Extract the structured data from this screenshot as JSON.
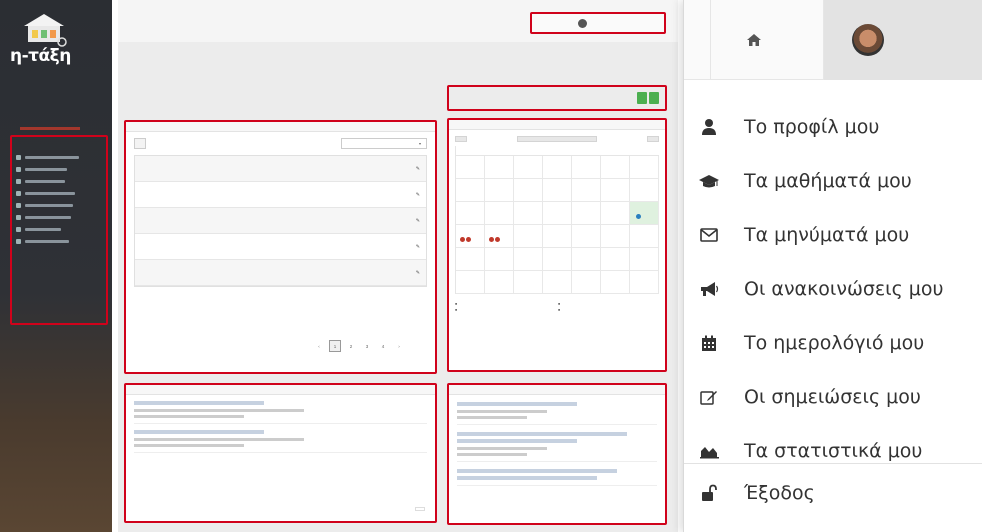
{
  "sidebar": {
    "brand": "η-τάξη",
    "section_label": "",
    "items": [
      {
        "icon": "dashboard-icon"
      },
      {
        "icon": "book-icon"
      },
      {
        "icon": "envelope-icon"
      },
      {
        "icon": "bullhorn-icon"
      },
      {
        "icon": "calendar-icon"
      },
      {
        "icon": "edit-icon"
      },
      {
        "icon": "chart-icon"
      },
      {
        "icon": "logout-icon"
      }
    ]
  },
  "main": {
    "breadcrumb": "",
    "page_title": "",
    "user_box": {
      "left": "",
      "name": "",
      "right": ""
    },
    "buttons": {
      "register": "",
      "create": ""
    },
    "courses_panel": {
      "title": "",
      "tool_button": "",
      "tool_select": "",
      "rows": [
        "",
        "",
        "",
        "",
        ""
      ],
      "info": "",
      "pages": [
        "‹",
        "1",
        "2",
        "3",
        "4",
        "›"
      ]
    },
    "calendar_panel": {
      "title": "",
      "prev": "",
      "month": "",
      "next": "",
      "weekdays": [
        "",
        "",
        "",
        "",
        "",
        "",
        ""
      ]
    },
    "announcements_panel": {
      "title": "",
      "all": ""
    },
    "messages_panel": {
      "title": ""
    }
  },
  "dropdown": {
    "home_icon": "home-icon",
    "avatar": "user-avatar",
    "items": [
      {
        "icon": "user-icon",
        "label": "Το προφίλ μου"
      },
      {
        "icon": "graduation-cap-icon",
        "label": "Τα μαθήματά μου"
      },
      {
        "icon": "envelope-icon",
        "label": "Τα μηνύματά μου"
      },
      {
        "icon": "bullhorn-icon",
        "label": "Οι ανακοινώσεις μου"
      },
      {
        "icon": "calendar-icon",
        "label": "Το ημερολόγιό μου"
      },
      {
        "icon": "edit-icon",
        "label": "Οι σημειώσεις μου"
      },
      {
        "icon": "area-chart-icon",
        "label": "Τα στατιστικά μου"
      }
    ],
    "logout": {
      "icon": "unlock-icon",
      "label": "Έξοδος"
    }
  },
  "colors": {
    "highlight": "#d0021b",
    "accent_green": "#4caf50",
    "sidebar_bg": "#2f3136"
  }
}
